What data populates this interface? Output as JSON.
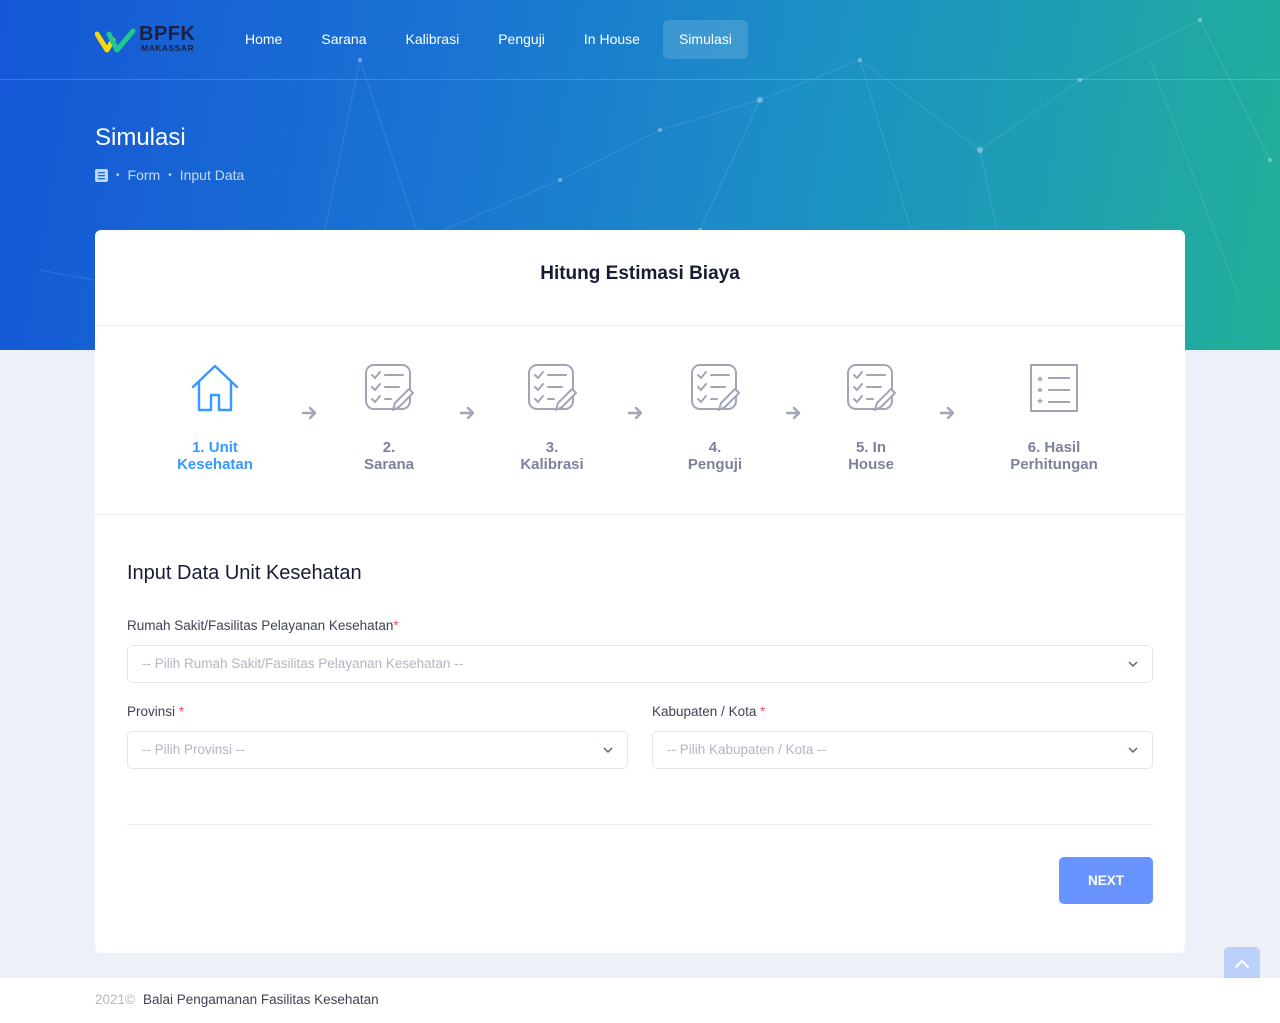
{
  "brand": {
    "name": "BPFK",
    "sub": "MAKASSAR"
  },
  "nav": {
    "items": [
      {
        "label": "Home",
        "active": false
      },
      {
        "label": "Sarana",
        "active": false
      },
      {
        "label": "Kalibrasi",
        "active": false
      },
      {
        "label": "Penguji",
        "active": false
      },
      {
        "label": "In House",
        "active": false
      },
      {
        "label": "Simulasi",
        "active": true
      }
    ]
  },
  "page": {
    "title": "Simulasi",
    "breadcrumb": {
      "icon": "list-icon",
      "items": [
        "Form",
        "Input Data"
      ],
      "separator": "•"
    }
  },
  "card": {
    "title": "Hitung Estimasi Biaya",
    "steps": [
      {
        "line1": "1. Unit",
        "line2": "Kesehatan",
        "icon": "home-icon",
        "current": true
      },
      {
        "line1": "2.",
        "line2": "Sarana",
        "icon": "checklist-edit-icon",
        "current": false
      },
      {
        "line1": "3.",
        "line2": "Kalibrasi",
        "icon": "checklist-edit-icon",
        "current": false
      },
      {
        "line1": "4.",
        "line2": "Penguji",
        "icon": "checklist-edit-icon",
        "current": false
      },
      {
        "line1": "5. In",
        "line2": "House",
        "icon": "checklist-edit-icon",
        "current": false
      },
      {
        "line1": "6. Hasil",
        "line2": "Perhitungan",
        "icon": "list-doc-icon",
        "current": false
      }
    ],
    "form": {
      "heading": "Input Data Unit Kesehatan",
      "hospital": {
        "label": "Rumah Sakit/Fasilitas Pelayanan Kesehatan",
        "required": "*",
        "placeholder": "-- Pilih Rumah Sakit/Fasilitas Pelayanan Kesehatan --"
      },
      "province": {
        "label": "Provinsi",
        "required": "*",
        "placeholder": "-- Pilih Provinsi --"
      },
      "city": {
        "label": "Kabupaten / Kota",
        "required": "*",
        "placeholder": "-- Pilih Kabupaten / Kota --"
      }
    },
    "next_label": "NEXT"
  },
  "footer": {
    "year": "2021©",
    "org": "Balai Pengamanan Fasilitas Kesehatan"
  },
  "colors": {
    "accent": "#3699ff",
    "button": "#6993ff",
    "hero_start": "#1556d6",
    "hero_end": "#23b098"
  }
}
